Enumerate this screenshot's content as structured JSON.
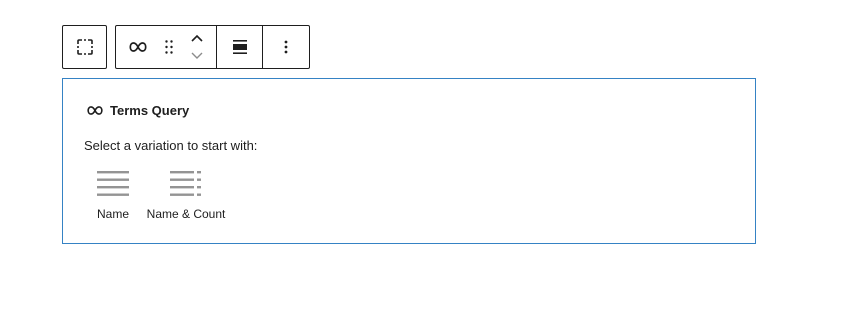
{
  "toolbar": {
    "select_parent": {
      "icon": "select-parent-icon"
    },
    "block_type": {
      "icon": "infinity-loop-icon"
    },
    "drag_handle": {
      "icon": "drag-handle-icon"
    },
    "move_up": {
      "icon": "chevron-up-icon"
    },
    "move_down": {
      "icon": "chevron-down-icon"
    },
    "align": {
      "icon": "align-wide-icon"
    },
    "options": {
      "icon": "more-vertical-icon"
    }
  },
  "placeholder": {
    "label": "Terms Query",
    "icon": "infinity-loop-icon",
    "instructions": "Select a variation to start with:",
    "variations": [
      {
        "label": "Name",
        "icon": "list-lines-icon"
      },
      {
        "label": "Name & Count",
        "icon": "list-lines-count-icon"
      }
    ]
  },
  "colors": {
    "accent_border": "#3582c4",
    "toolbar_border": "#1e1e1e",
    "icon_gray": "#949494",
    "text": "#1e1e1e"
  }
}
